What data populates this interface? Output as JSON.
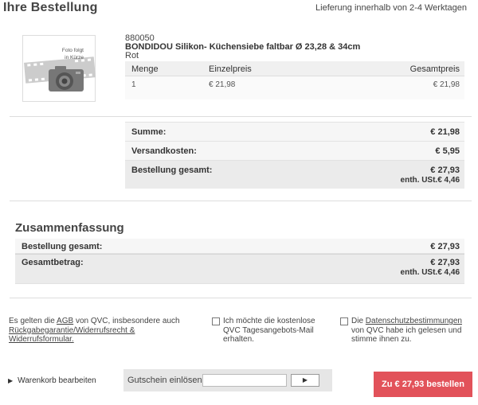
{
  "header": {
    "title": "Ihre Bestellung",
    "delivery": "Lieferung innerhalb von 2-4 Werktagen"
  },
  "product": {
    "image_placeholder_line1": "Foto folgt",
    "image_placeholder_line2": "in Kürze",
    "sku": "880050",
    "name": "BONDIDOU Silikon- Küchensiebe faltbar Ø 23,28 & 34cm",
    "color": "Rot",
    "columns": [
      "Menge",
      "Einzelpreis",
      "Gesamtpreis"
    ],
    "row": {
      "quantity": "1",
      "unit_price": "€ 21,98",
      "total_price": "€ 21,98"
    }
  },
  "totals": {
    "sum_label": "Summe:",
    "sum_value": "€ 21,98",
    "shipping_label": "Versandkosten:",
    "shipping_value": "€ 5,95",
    "order_total_label": "Bestellung gesamt:",
    "order_total_value": "€ 27,93",
    "vat": "enth. USt.€ 4,46"
  },
  "summary": {
    "title": "Zusammenfassung",
    "order_total_label": "Bestellung gesamt:",
    "order_total_value": "€ 27,93",
    "grand_total_label": "Gesamtbetrag:",
    "grand_total_value": "€ 27,93",
    "vat": "enth. USt.€ 4,46"
  },
  "legal": {
    "terms_prefix": "Es gelten die ",
    "terms_link": "AGB",
    "terms_middle": " von QVC, insbesondere auch ",
    "returns_link": "Rückgabegarantie/Widerrufsrecht & Widerrufsformular.",
    "newsletter": "Ich möchte die kostenlose QVC Tagesangebots-Mail erhalten.",
    "privacy_prefix": "Die ",
    "privacy_link": "Datenschutzbestimmungen",
    "privacy_suffix": " von QVC habe ich gelesen und stimme ihnen zu."
  },
  "footer": {
    "edit_cart": "Warenkorb bearbeiten",
    "coupon_label": "Gutschein einlösen",
    "coupon_value": "",
    "coupon_submit": "▶",
    "order_button": "Zu € 27,93 bestellen"
  },
  "colors": {
    "order_button": "#e2525a"
  }
}
